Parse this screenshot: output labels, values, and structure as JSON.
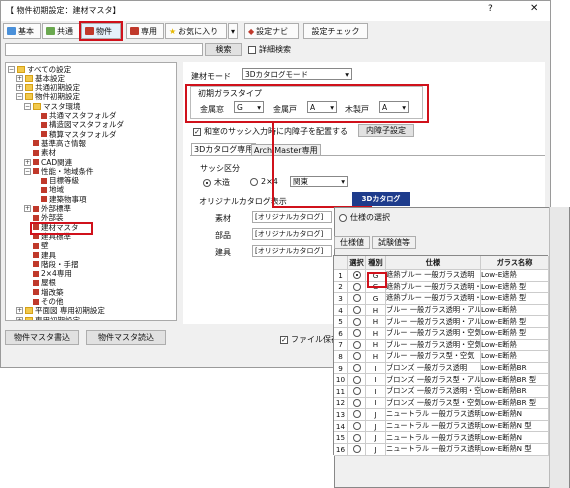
{
  "window": {
    "title": "【 物件初期設定：建材マスタ】",
    "help": "?",
    "close": "✕"
  },
  "toolbar": {
    "tabs": [
      "基本",
      "共通",
      "物件",
      "専用",
      "お気に入り"
    ],
    "dropdown": "▾",
    "settings_navi": "設定ナビ",
    "settings_check": "設定チェック"
  },
  "search": {
    "value": "",
    "button": "検索",
    "advanced": "詳細検索"
  },
  "tree": [
    {
      "label": "すべての設定",
      "exp": "−",
      "icon": "fold"
    },
    {
      "label": "基本設定",
      "exp": "+",
      "icon": "fold"
    },
    {
      "label": "共通初期設定",
      "exp": "+",
      "icon": "fold"
    },
    {
      "label": "物件初期設定",
      "exp": "−",
      "icon": "fold"
    },
    {
      "label": "マスタ環境",
      "exp": "−",
      "icon": "fold"
    },
    {
      "label": "共通マスタフォルダ",
      "exp": "",
      "icon": "red"
    },
    {
      "label": "構造図マスタフォルダ",
      "exp": "",
      "icon": "red"
    },
    {
      "label": "積算マスタフォルダ",
      "exp": "",
      "icon": "red"
    },
    {
      "label": "基準高さ情報",
      "exp": "",
      "icon": "red"
    },
    {
      "label": "素材",
      "exp": "",
      "icon": "red"
    },
    {
      "label": "CAD関連",
      "exp": "+",
      "icon": "red"
    },
    {
      "label": "性能・地域条件",
      "exp": "−",
      "icon": "red"
    },
    {
      "label": "目標等級",
      "exp": "",
      "icon": "red"
    },
    {
      "label": "地域",
      "exp": "",
      "icon": "red"
    },
    {
      "label": "建築物事項",
      "exp": "",
      "icon": "red"
    },
    {
      "label": "外部標準",
      "exp": "+",
      "icon": "red"
    },
    {
      "label": "外部装",
      "exp": "",
      "icon": "red"
    },
    {
      "label": "建材マスタ",
      "exp": "",
      "icon": "red"
    },
    {
      "label": "建具標準",
      "exp": "",
      "icon": "red"
    },
    {
      "label": "壁",
      "exp": "",
      "icon": "red"
    },
    {
      "label": "建具",
      "exp": "",
      "icon": "red"
    },
    {
      "label": "階段・手摺",
      "exp": "",
      "icon": "red"
    },
    {
      "label": "2×4専用",
      "exp": "",
      "icon": "red"
    },
    {
      "label": "屋根",
      "exp": "",
      "icon": "red"
    },
    {
      "label": "増改築",
      "exp": "",
      "icon": "red"
    },
    {
      "label": "その他",
      "exp": "",
      "icon": "red"
    },
    {
      "label": "平面図 専用初期設定",
      "exp": "+",
      "icon": "fold"
    },
    {
      "label": "専用初期設定",
      "exp": "+",
      "icon": "fold"
    }
  ],
  "bottom_buttons": {
    "write": "物件マスタ書込",
    "read": "物件マスタ読込"
  },
  "file_save": "ファイル保存",
  "panel": {
    "mode_label": "建材モード",
    "mode_value": "3Dカタログモード",
    "glass_title": "初期ガラスタイプ",
    "glass": [
      {
        "label": "金属窓",
        "value": "G"
      },
      {
        "label": "金属戸",
        "value": "A"
      },
      {
        "label": "木製戸",
        "value": "A"
      }
    ],
    "sash_check": "和室のサッシ入力時に内障子を配置する",
    "inner_button": "内障子設定",
    "tabs": [
      "3Dカタログ専用",
      "ArchiMaster専用"
    ],
    "sash_group": "サッシ区分",
    "sash_radio": [
      "木造",
      "2×4"
    ],
    "region": "関東",
    "catalog_label": "オリジナルカタログ表示",
    "catalog_button": "3Dカタログ",
    "rows": [
      {
        "label": "素材",
        "value": "[オリジナルカタログ]"
      },
      {
        "label": "部品",
        "value": "[オリジナルカタログ]"
      },
      {
        "label": "建具",
        "value": "[オリジナルカタログ]"
      }
    ]
  },
  "popup": {
    "spec_radio": "仕様の選択",
    "tabs": [
      "仕様値",
      "試験値等"
    ],
    "headers": [
      "",
      "選択",
      "種別",
      "仕様",
      "ガラス名称"
    ],
    "rows": [
      {
        "no": "1",
        "sel": true,
        "type": "G",
        "spec": "遮熱ブルー 一般ガラス透明",
        "glass": "Low-E遮熱"
      },
      {
        "no": "2",
        "sel": false,
        "type": "G",
        "spec": "遮熱ブルー 一般ガラス透明・型",
        "glass": "Low-E遮熱 型"
      },
      {
        "no": "3",
        "sel": false,
        "type": "G",
        "spec": "遮熱ブルー 一般ガラス透明・空",
        "glass": "Low-E遮熱 型"
      },
      {
        "no": "4",
        "sel": false,
        "type": "H",
        "spec": "ブルー 一般ガラス透明・アル",
        "glass": "Low-E断熱"
      },
      {
        "no": "5",
        "sel": false,
        "type": "H",
        "spec": "ブルー 一般ガラス透明・アル",
        "glass": "Low-E断熱 型"
      },
      {
        "no": "6",
        "sel": false,
        "type": "H",
        "spec": "ブルー 一般ガラス透明・空気",
        "glass": "Low-E断熱 型"
      },
      {
        "no": "7",
        "sel": false,
        "type": "H",
        "spec": "ブルー 一般ガラス透明・空気",
        "glass": "Low-E断熱"
      },
      {
        "no": "8",
        "sel": false,
        "type": "H",
        "spec": "ブルー 一般ガラス型・空気",
        "glass": "Low-E断熱"
      },
      {
        "no": "9",
        "sel": false,
        "type": "I",
        "spec": "ブロンズ 一般ガラス透明",
        "glass": "Low-E断熱BR"
      },
      {
        "no": "10",
        "sel": false,
        "type": "I",
        "spec": "ブロンズ 一般ガラス型・アル",
        "glass": "Low-E断熱BR 型"
      },
      {
        "no": "11",
        "sel": false,
        "type": "I",
        "spec": "ブロンズ 一般ガラス透明・空",
        "glass": "Low-E断熱BR"
      },
      {
        "no": "12",
        "sel": false,
        "type": "I",
        "spec": "ブロンズ 一般ガラス型・空気",
        "glass": "Low-E断熱BR 型"
      },
      {
        "no": "13",
        "sel": false,
        "type": "J",
        "spec": "ニュートラル 一般ガラス透明",
        "glass": "Low-E断熱N"
      },
      {
        "no": "14",
        "sel": false,
        "type": "J",
        "spec": "ニュートラル 一般ガラス透明",
        "glass": "Low-E断熱N 型"
      },
      {
        "no": "15",
        "sel": false,
        "type": "J",
        "spec": "ニュートラル 一般ガラス透明",
        "glass": "Low-E断熱N"
      },
      {
        "no": "16",
        "sel": false,
        "type": "J",
        "spec": "ニュートラル 一般ガラス透明",
        "glass": "Low-E断熱N 型"
      }
    ]
  },
  "colors": {
    "highlight": "#d0111b"
  }
}
